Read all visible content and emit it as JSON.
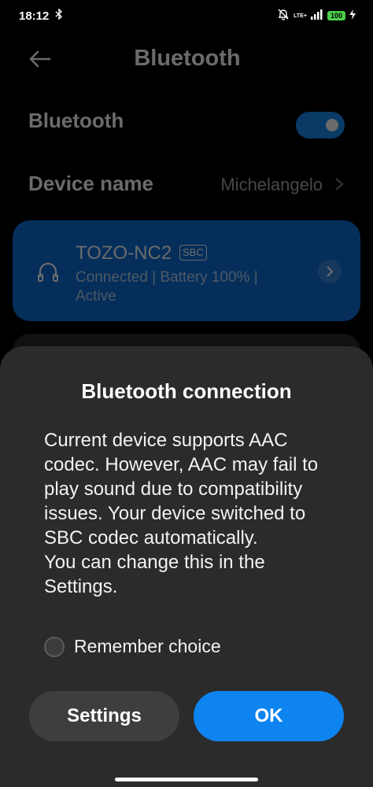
{
  "status_bar": {
    "time": "18:12",
    "network": "LTE+",
    "battery": "100"
  },
  "header": {
    "title": "Bluetooth"
  },
  "settings": {
    "bluetooth_label": "Bluetooth",
    "bluetooth_enabled": true,
    "device_name_label": "Device name",
    "device_name_value": "Michelangelo"
  },
  "device": {
    "name": "TOZO-NC2",
    "codec": "SBC",
    "status": "Connected | Battery 100% | Active"
  },
  "dialog": {
    "title": "Bluetooth connection",
    "message": "Current device supports AAC codec. However, AAC may fail to play sound due to compatibility issues. Your device switched to SBC codec automatically.",
    "message2": "You can change this in the Settings.",
    "remember_label": "Remember choice",
    "remember_checked": false,
    "settings_button": "Settings",
    "ok_button": "OK"
  },
  "colors": {
    "accent": "#0d84f0",
    "card": "#0d6fd9",
    "dialog_bg": "#2b2b2b",
    "battery": "#4ccf4a"
  },
  "icons": {
    "back": "arrow-left-icon",
    "bluetooth_status": "bluetooth-icon",
    "mute": "bell-off-icon",
    "signal": "signal-icon",
    "battery": "battery-icon",
    "charging": "bolt-icon",
    "device": "headphones-icon",
    "chevron": "chevron-right-icon"
  }
}
